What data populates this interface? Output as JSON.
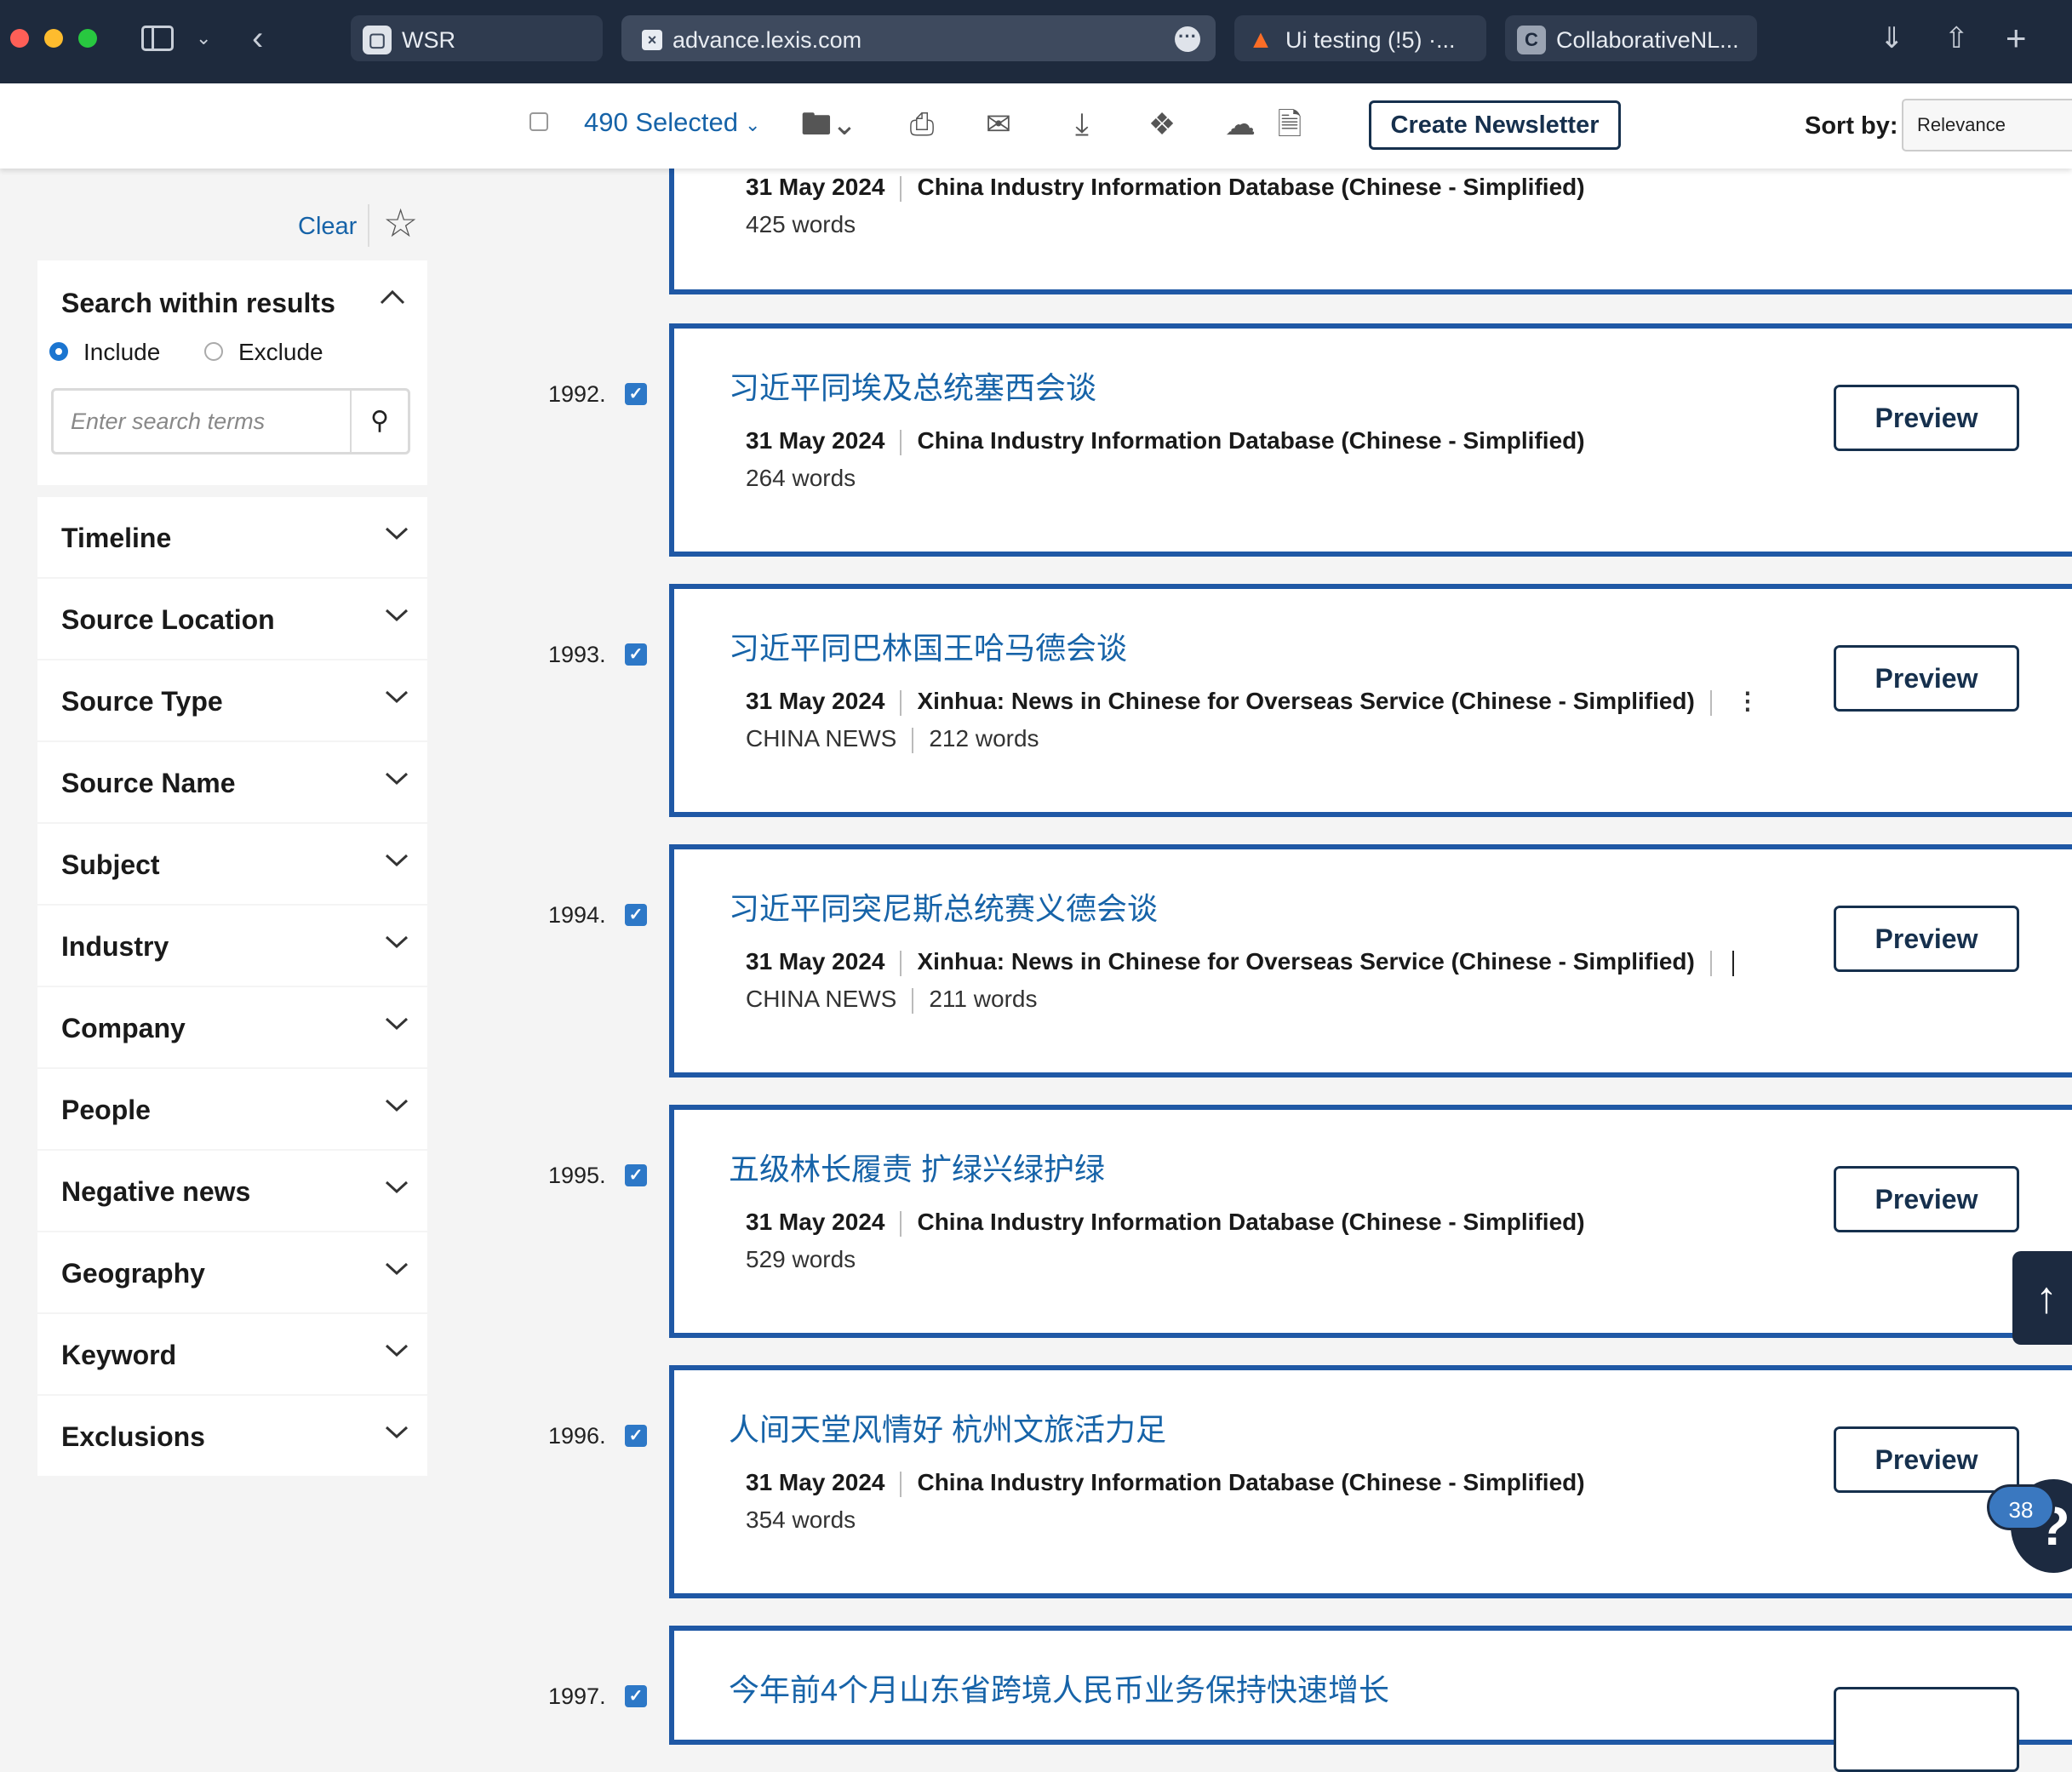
{
  "browser": {
    "tabs": [
      {
        "label": "WSR"
      },
      {
        "label": "advance.lexis.com"
      },
      {
        "label": "Ui testing (!5) ·..."
      },
      {
        "label": "CollaborativeNL..."
      }
    ]
  },
  "toolbar": {
    "selected_label": "490 Selected",
    "newsletter_label": "Create Newsletter",
    "sort_label": "Sort by:",
    "sort_value": "Relevance"
  },
  "filters": {
    "clear_label": "Clear",
    "search_within": {
      "title": "Search within results",
      "include_label": "Include",
      "exclude_label": "Exclude",
      "placeholder": "Enter search terms"
    },
    "facets": [
      {
        "label": "Timeline"
      },
      {
        "label": "Source Location"
      },
      {
        "label": "Source Type"
      },
      {
        "label": "Source Name"
      },
      {
        "label": "Subject"
      },
      {
        "label": "Industry"
      },
      {
        "label": "Company"
      },
      {
        "label": "People"
      },
      {
        "label": "Negative news"
      },
      {
        "label": "Geography"
      },
      {
        "label": "Keyword"
      },
      {
        "label": "Exclusions"
      }
    ]
  },
  "results": {
    "preview_label": "Preview",
    "partial_top": {
      "date": "31 May 2024",
      "source": "China Industry Information Database (Chinese - Simplified)",
      "words": "425 words"
    },
    "items": [
      {
        "num": "1992.",
        "title": "习近平同埃及总统塞西会谈",
        "date": "31 May 2024",
        "source": "China Industry Information Database (Chinese - Simplified)",
        "section": "",
        "words": "264 words"
      },
      {
        "num": "1993.",
        "title": "习近平同巴林国王哈马德会谈",
        "date": "31 May 2024",
        "source": "Xinhua: News in Chinese for Overseas Service (Chinese - Simplified)",
        "section": "CHINA NEWS",
        "words": "212 words"
      },
      {
        "num": "1994.",
        "title": "习近平同突尼斯总统赛义德会谈",
        "date": "31 May 2024",
        "source": "Xinhua: News in Chinese for Overseas Service (Chinese - Simplified)",
        "section": "CHINA NEWS",
        "words": "211 words"
      },
      {
        "num": "1995.",
        "title": "五级林长履责 扩绿兴绿护绿",
        "date": "31 May 2024",
        "source": "China Industry Information Database (Chinese - Simplified)",
        "section": "",
        "words": "529 words"
      },
      {
        "num": "1996.",
        "title": "人间天堂风情好 杭州文旅活力足",
        "date": "31 May 2024",
        "source": "China Industry Information Database (Chinese - Simplified)",
        "section": "",
        "words": "354 words"
      },
      {
        "num": "1997.",
        "title": "今年前4个月山东省跨境人民币业务保持快速增长"
      }
    ]
  },
  "help": {
    "badge_count": "38",
    "symbol": "?"
  },
  "colors": {
    "chrome_bg": "#1e2a3d",
    "link_blue": "#1663a8",
    "card_border": "#1f58a5",
    "button_navy": "#16304d"
  }
}
